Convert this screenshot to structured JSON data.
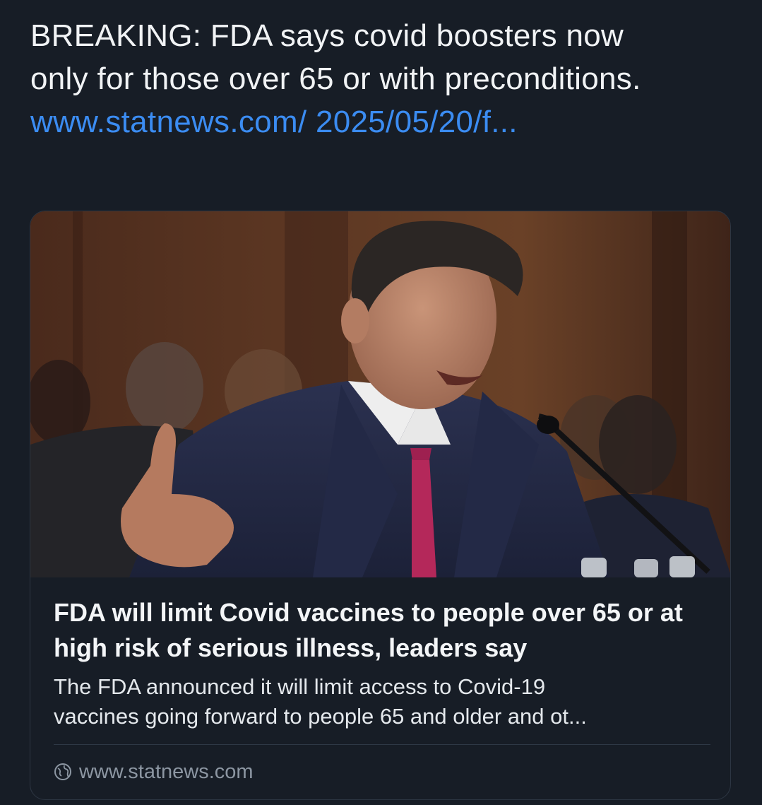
{
  "post": {
    "text": "BREAKING: FDA says covid boosters now only for those over 65 or with preconditions. ",
    "link_text": "www.statnews.com/ 2025/05/20/f..."
  },
  "card": {
    "image_icon": "photo-of-man-speaking-at-hearing",
    "title": "FDA will limit Covid vaccines to people over 65 or at high risk of serious illness, leaders say",
    "description_line1": "The FDA announced it will limit access to Covid-19",
    "description_line2": "vaccines going forward to people 65 and older and ot...",
    "domain": "www.statnews.com",
    "domain_icon": "globe-icon"
  },
  "colors": {
    "background": "#171d26",
    "link": "#3b8cf2",
    "border": "#2d3643",
    "muted_text": "#8c96a2"
  }
}
